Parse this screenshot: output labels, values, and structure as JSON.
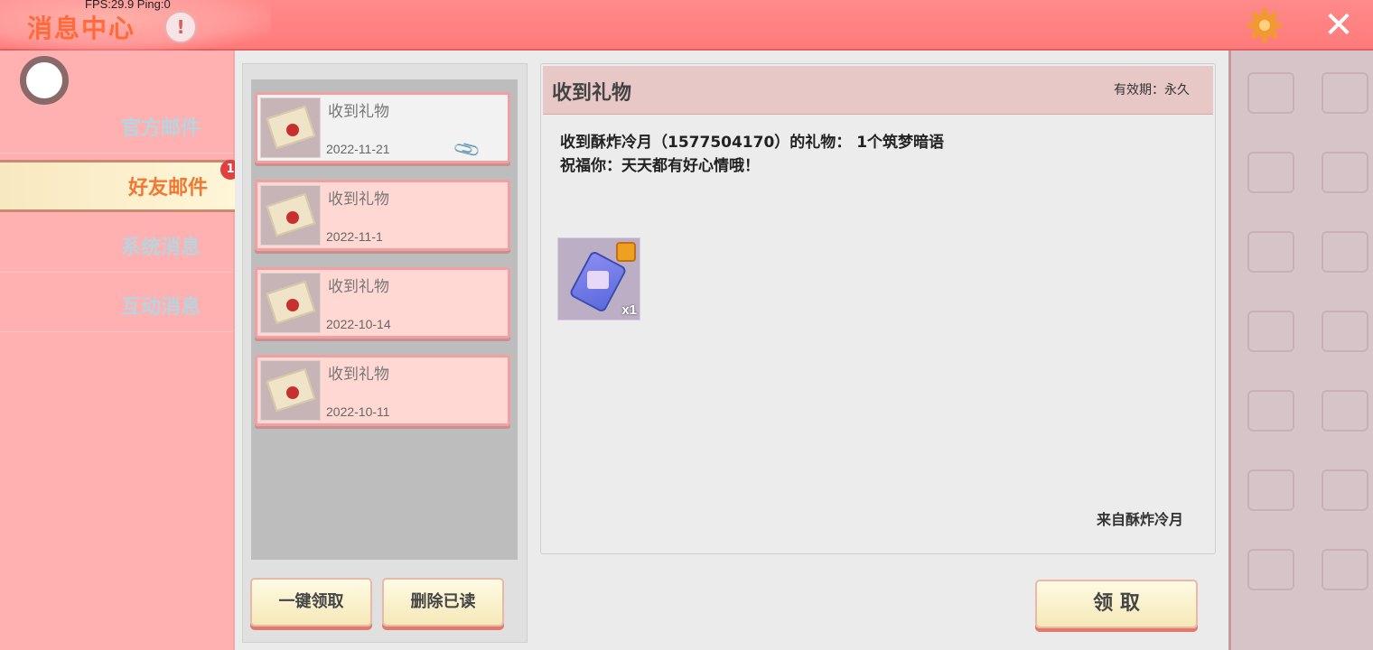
{
  "header": {
    "title": "消息中心",
    "fps_text": "FPS:29.9  Ping:0",
    "warn_glyph": "!",
    "close_glyph": "✕"
  },
  "sidebar": {
    "items": [
      {
        "label": "官方邮件"
      },
      {
        "label": "好友邮件",
        "active": true,
        "badge": "1"
      },
      {
        "label": "系统消息"
      },
      {
        "label": "互动消息"
      }
    ]
  },
  "mail_list": [
    {
      "title": "收到礼物",
      "date": "2022-11-21",
      "selected": true,
      "has_attachment_icon": true
    },
    {
      "title": "收到礼物",
      "date": "2022-11-1"
    },
    {
      "title": "收到礼物",
      "date": "2022-10-14"
    },
    {
      "title": "收到礼物",
      "date": "2022-10-11"
    }
  ],
  "list_buttons": {
    "claim_all": "一键领取",
    "delete_read": "删除已读"
  },
  "detail": {
    "title": "收到礼物",
    "validity": "有效期：永久",
    "line1": "收到酥炸冷月（1577504170）的礼物： 1个筑梦暗语",
    "line2": "祝福你：天天都有好心情哦！",
    "item_qty": "x1",
    "sender": "来自酥炸冷月",
    "claim_button": "领 取"
  },
  "colors": {
    "title_bar": "#ff7a7a",
    "sidebar_bg": "#ffb0b0",
    "active_tab_text": "#f07830",
    "inactive_tab_text": "#b8d4de",
    "badge": "#e04040"
  }
}
